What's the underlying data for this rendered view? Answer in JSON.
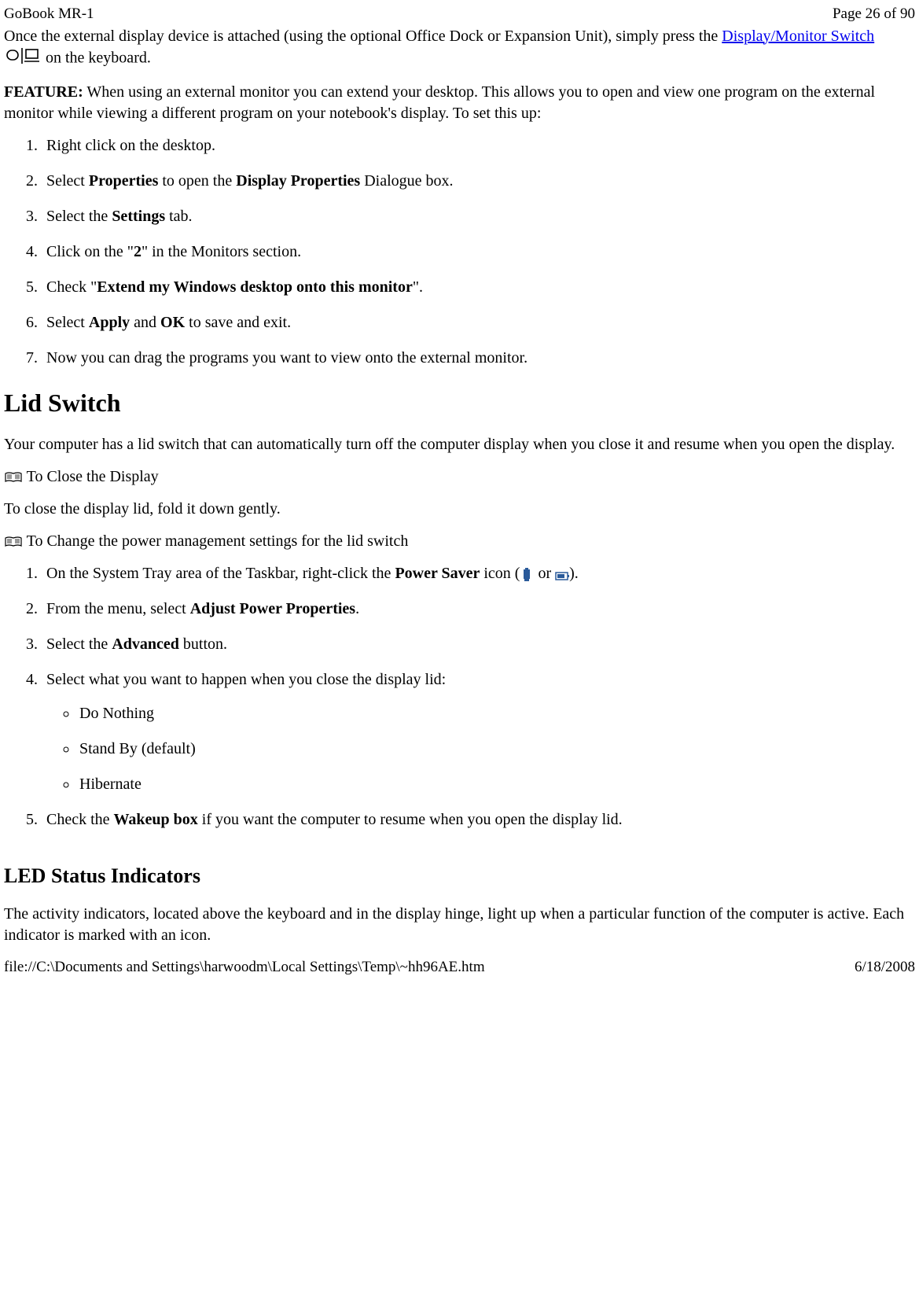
{
  "header": {
    "left": "GoBook MR-1",
    "right": "Page 26 of 90"
  },
  "intro": {
    "pre": "Once the external display device is attached (using the optional Office Dock or Expansion Unit), simply press the ",
    "link": "Display/Monitor Switch",
    "post": " on the keyboard."
  },
  "feature": {
    "label": "FEATURE:",
    "text": "  When using an external monitor you can extend your desktop. This allows you to open and view one program on the external monitor while viewing a different program on your notebook's display. To set this up:"
  },
  "feature_steps": {
    "s1": "Right click on the desktop.",
    "s2a": "Select ",
    "s2b": "Properties",
    "s2c": " to open the ",
    "s2d": "Display Properties",
    "s2e": " Dialogue box.",
    "s3a": "Select the ",
    "s3b": "Settings",
    "s3c": " tab.",
    "s4a": "Click on the \"",
    "s4b": "2",
    "s4c": "\" in the Monitors section.",
    "s5a": "Check \"",
    "s5b": "Extend my Windows desktop onto this monitor",
    "s5c": "\".",
    "s6a": "Select ",
    "s6b": "Apply",
    "s6c": " and ",
    "s6d": "OK",
    "s6e": " to save and exit.",
    "s7": "Now you can drag the programs you want to view onto the external monitor."
  },
  "lid": {
    "heading": "Lid Switch",
    "intro": "Your computer has a lid switch that can automatically turn off the computer display when you close it and resume when you open the display.",
    "sub1": "  To Close the Display",
    "close_text": "To close the display lid, fold it down gently.",
    "sub2": " To Change the power management settings for the lid switch"
  },
  "lid_steps": {
    "s1a": "On the System Tray area of the Taskbar, right-click the ",
    "s1b": "Power Saver",
    "s1c": " icon (",
    "s1d": " or  ",
    "s1e": ").",
    "s2a": "From the menu, select ",
    "s2b": "Adjust Power Properties",
    "s2c": ".",
    "s3a": "Select the ",
    "s3b": "Advanced",
    "s3c": " button.",
    "s4": "Select what you want to happen when you close the display lid:",
    "opt1": "Do Nothing",
    "opt2": "Stand By (default)",
    "opt3": "Hibernate",
    "s5a": "Check the ",
    "s5b": "Wakeup box",
    "s5c": " if you want the computer to resume when you open the display lid."
  },
  "led": {
    "heading": "LED Status Indicators",
    "text": "The activity indicators, located above the keyboard and in the display hinge, light up when a particular function of the computer is active. Each indicator is marked with an icon."
  },
  "footer": {
    "left": "file://C:\\Documents and Settings\\harwoodm\\Local Settings\\Temp\\~hh96AE.htm",
    "right": "6/18/2008"
  }
}
